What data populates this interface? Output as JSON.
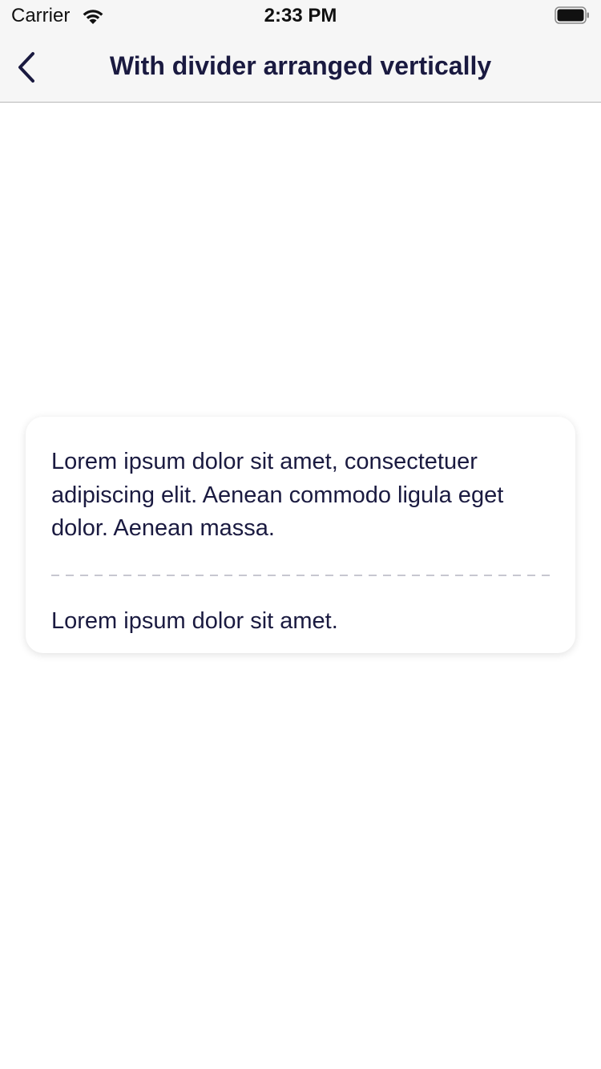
{
  "status_bar": {
    "carrier": "Carrier",
    "time": "2:33 PM"
  },
  "nav": {
    "title": "With divider arranged vertically",
    "back_icon": "chevron-left-icon"
  },
  "card": {
    "first_text": "Lorem ipsum dolor sit amet, consectetuer adipiscing elit. Aenean commodo ligula eget dolor. Aenean massa.",
    "second_text": "Lorem ipsum dolor sit amet."
  },
  "colors": {
    "text": "#1a1a40",
    "divider": "#c7c7d0",
    "bar_background": "#f6f6f6"
  }
}
